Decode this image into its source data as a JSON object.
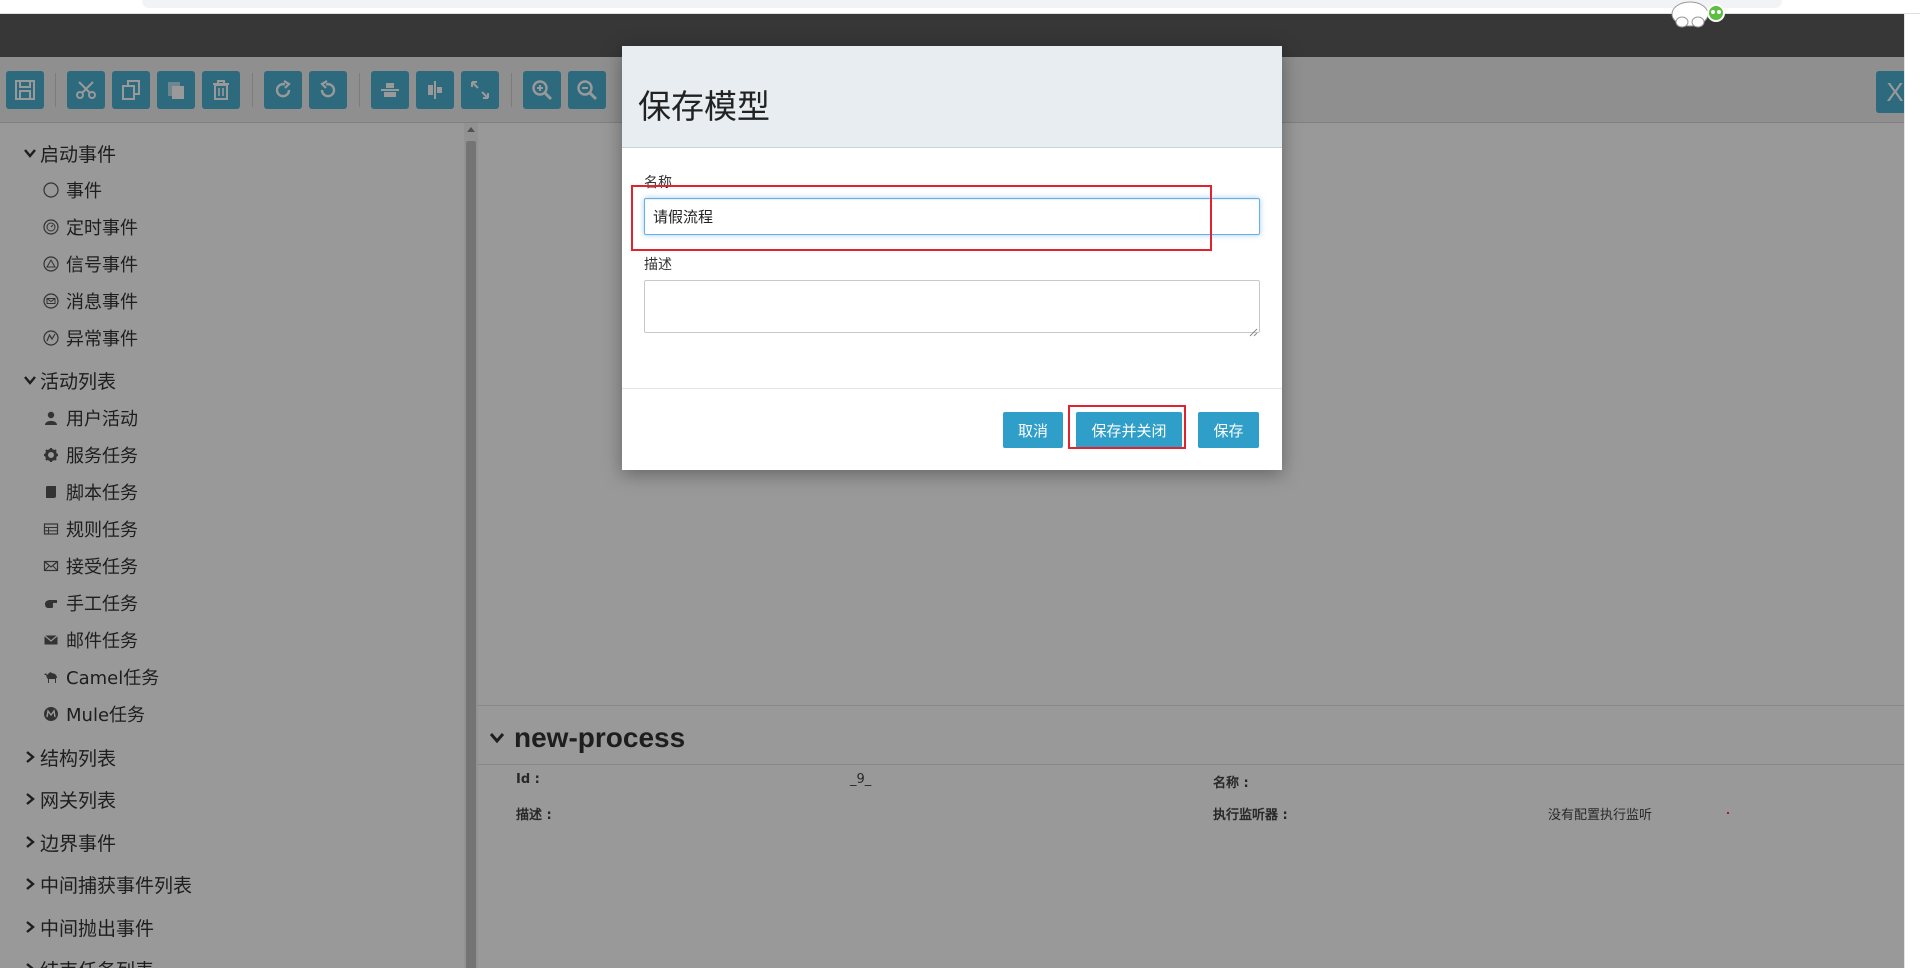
{
  "modal": {
    "title": "保存模型",
    "name_label": "名称",
    "name_value": "请假流程",
    "description_label": "描述",
    "description_value": "",
    "buttons": {
      "cancel": "取消",
      "save_and_close": "保存并关闭",
      "save": "保存"
    }
  },
  "toolbar": {
    "close_label": "X",
    "icons": [
      "save-icon",
      "cut-icon",
      "copy-icon",
      "paste-icon",
      "delete-icon",
      "redo-icon",
      "undo-icon",
      "align-horizontal-icon",
      "align-vertical-icon",
      "same-size-icon",
      "zoom-in-icon",
      "zoom-out-icon"
    ]
  },
  "palette": {
    "groups": [
      {
        "label": "启动事件",
        "expanded": true,
        "items": [
          {
            "label": "事件",
            "icon": "circle-icon"
          },
          {
            "label": "定时事件",
            "icon": "timer-icon"
          },
          {
            "label": "信号事件",
            "icon": "signal-icon"
          },
          {
            "label": "消息事件",
            "icon": "message-icon"
          },
          {
            "label": "异常事件",
            "icon": "error-icon"
          }
        ]
      },
      {
        "label": "活动列表",
        "expanded": true,
        "items": [
          {
            "label": "用户活动",
            "icon": "user-icon"
          },
          {
            "label": "服务任务",
            "icon": "gear-icon"
          },
          {
            "label": "脚本任务",
            "icon": "script-icon"
          },
          {
            "label": "规则任务",
            "icon": "table-icon"
          },
          {
            "label": "接受任务",
            "icon": "envelope-icon"
          },
          {
            "label": "手工任务",
            "icon": "hand-icon"
          },
          {
            "label": "邮件任务",
            "icon": "mail-icon"
          },
          {
            "label": "Camel任务",
            "icon": "camel-icon"
          },
          {
            "label": "Mule任务",
            "icon": "mule-icon"
          }
        ]
      },
      {
        "label": "结构列表",
        "expanded": false,
        "items": []
      },
      {
        "label": "网关列表",
        "expanded": false,
        "items": []
      },
      {
        "label": "边界事件",
        "expanded": false,
        "items": []
      },
      {
        "label": "中间捕获事件列表",
        "expanded": false,
        "items": []
      },
      {
        "label": "中间抛出事件",
        "expanded": false,
        "items": []
      },
      {
        "label": "结束任务列表",
        "expanded": false,
        "items": []
      }
    ]
  },
  "properties": {
    "title": "new-process",
    "id_label": "Id :",
    "id_value": "_9_",
    "name_label": "名称 :",
    "name_value": "",
    "description_label": "描述 :",
    "description_value": "",
    "listener_label": "执行监听器 :",
    "listener_value": "没有配置执行监听"
  },
  "colors": {
    "accent": "#2f9ec8",
    "toolbar_button": "#4cb1d2",
    "highlight": "#e0232f",
    "header_bar": "#5c5c5c"
  }
}
